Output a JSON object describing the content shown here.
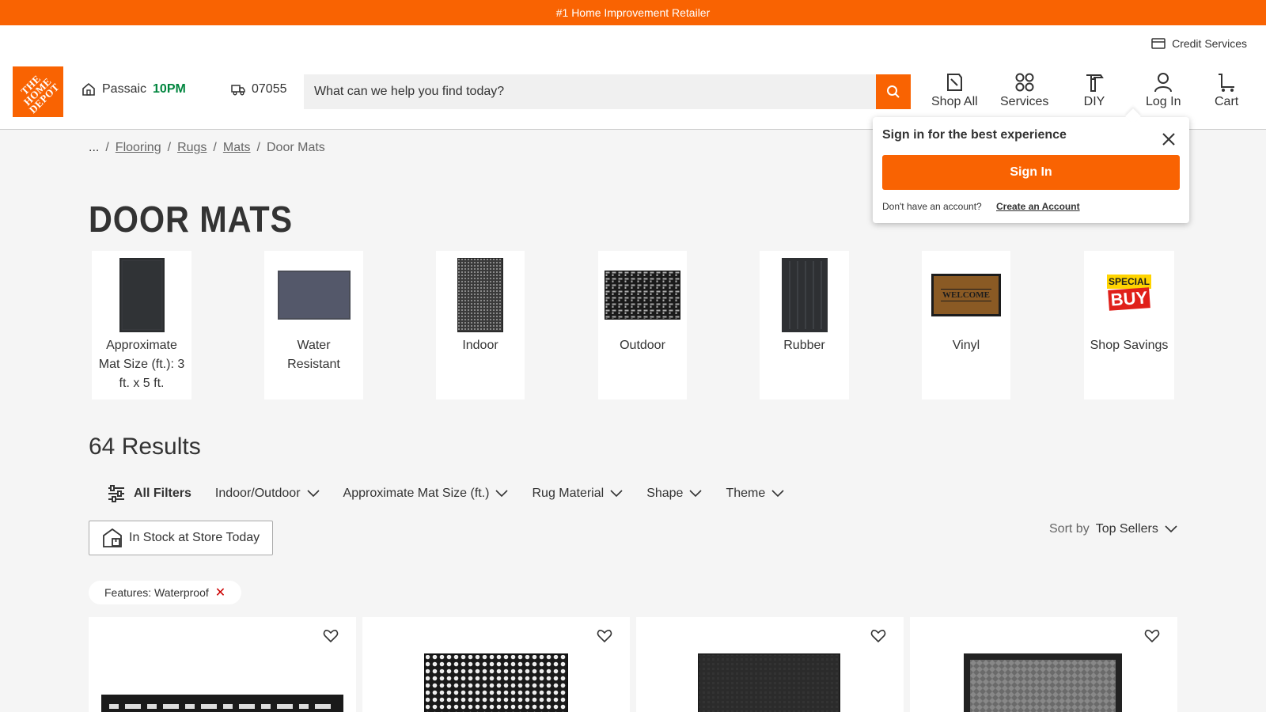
{
  "promo": "#1 Home Improvement Retailer",
  "header": {
    "credit_services": "Credit Services",
    "logo_text": "THE HOME DEPOT",
    "store_name": "Passaic",
    "store_hours": "10PM",
    "zip": "07055",
    "search_placeholder": "What can we help you find today?",
    "nav": [
      {
        "label": "Shop All",
        "icon": "shop-all-icon"
      },
      {
        "label": "Services",
        "icon": "services-icon"
      },
      {
        "label": "DIY",
        "icon": "diy-icon"
      },
      {
        "label": "Log In",
        "icon": "user-icon"
      },
      {
        "label": "Cart",
        "icon": "cart-icon"
      }
    ]
  },
  "breadcrumb": {
    "ellipsis": "...",
    "items": [
      "Flooring",
      "Rugs",
      "Mats"
    ],
    "current": "Door Mats"
  },
  "page_title": "DOOR MATS",
  "signin_popover": {
    "title": "Sign in for the best experience",
    "button": "Sign In",
    "no_account": "Don't have an account?",
    "create": "Create an Account"
  },
  "categories": [
    {
      "label": "Approximate Mat Size (ft.): 3 ft. x 5 ft."
    },
    {
      "label": "Water Resistant"
    },
    {
      "label": "Indoor"
    },
    {
      "label": "Outdoor"
    },
    {
      "label": "Rubber"
    },
    {
      "label": "Vinyl",
      "image_text": "WELCOME"
    },
    {
      "label": "Shop Savings",
      "image_text_top": "SPECIAL",
      "image_text_bottom": "BUY"
    }
  ],
  "results": "64 Results",
  "filters": {
    "all": "All Filters",
    "dropdowns": [
      "Indoor/Outdoor",
      "Approximate Mat Size (ft.)",
      "Rug Material",
      "Shape",
      "Theme"
    ]
  },
  "in_stock": "In Stock at Store Today",
  "sort": {
    "label": "Sort by",
    "value": "Top Sellers"
  },
  "applied_filter": {
    "text": "Features: Waterproof",
    "remove": "✕"
  },
  "colors": {
    "brand": "#f96302",
    "hours": "#00853e"
  }
}
